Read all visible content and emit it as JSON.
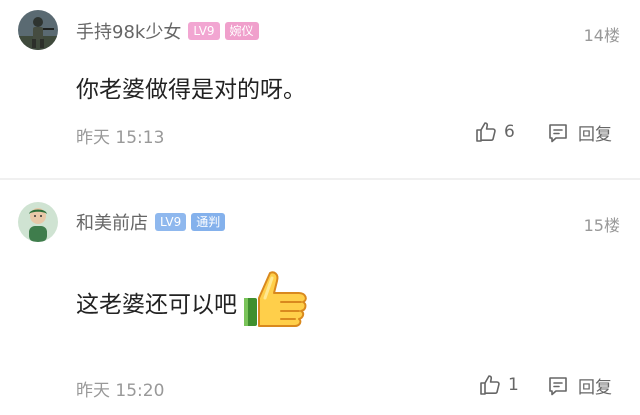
{
  "comments": [
    {
      "username": "手持98k少女",
      "level": "LV9",
      "title": "婉仪",
      "floor": "14楼",
      "text": "你老婆做得是对的呀。",
      "time": "昨天 15:13",
      "likes": "6",
      "reply_label": "回复",
      "avatar_icon": "soldier-avatar-icon",
      "badge_color": "pink"
    },
    {
      "username": "和美前店",
      "level": "LV9",
      "title": "通判",
      "floor": "15楼",
      "text": "这老婆还可以吧",
      "emoji": "thumbs-up-emoji",
      "time": "昨天 15:20",
      "likes": "1",
      "reply_label": "回复",
      "avatar_icon": "child-avatar-icon",
      "badge_color": "blue"
    }
  ],
  "colors": {
    "text_primary": "#222222",
    "text_secondary": "#999999",
    "badge_pink": "#f2a6d2",
    "badge_blue": "#8fb8ee"
  }
}
